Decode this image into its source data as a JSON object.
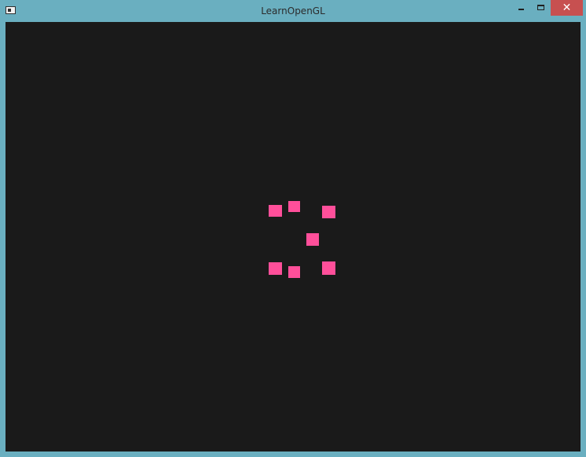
{
  "window": {
    "title": "LearnOpenGL",
    "close_glyph": "✕",
    "icons": {
      "app": "window-icon",
      "minimize": "minimize-icon",
      "maximize": "maximize-icon",
      "close": "close-icon"
    }
  },
  "scene": {
    "background_color": "#1a1a1a",
    "quad_color": "#ff4f9a",
    "quad_count": 7
  },
  "colors": {
    "titlebar": "#6aafc0",
    "close_button": "#c75050"
  }
}
